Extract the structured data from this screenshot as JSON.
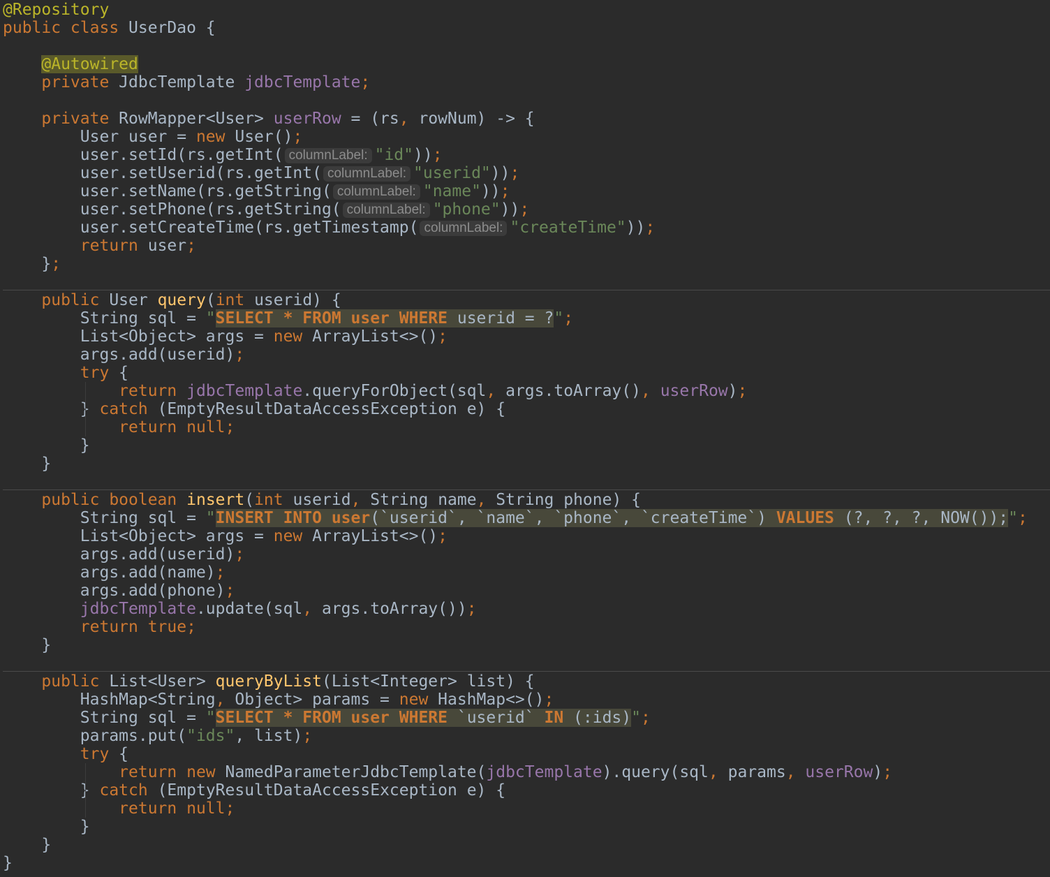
{
  "editor": {
    "lines": [
      [
        {
          "t": "@Repository",
          "c": "ann"
        }
      ],
      [
        {
          "t": "public class",
          "c": "kw"
        },
        {
          "t": " UserDao {"
        }
      ],
      [],
      [
        {
          "t": "    "
        },
        {
          "t": "@Autowired",
          "c": "ann-hl"
        }
      ],
      [
        {
          "t": "    "
        },
        {
          "t": "private",
          "c": "kw"
        },
        {
          "t": " JdbcTemplate "
        },
        {
          "t": "jdbcTemplate",
          "c": "fld"
        },
        {
          "t": ";",
          "c": "kw"
        }
      ],
      [],
      [
        {
          "t": "    "
        },
        {
          "t": "private",
          "c": "kw"
        },
        {
          "t": " RowMapper<User> "
        },
        {
          "t": "userRow",
          "c": "fld"
        },
        {
          "t": " = (rs"
        },
        {
          "t": ",",
          "c": "kw"
        },
        {
          "t": " rowNum) -> {"
        }
      ],
      [
        {
          "t": "        User user = "
        },
        {
          "t": "new",
          "c": "kw"
        },
        {
          "t": " User()"
        },
        {
          "t": ";",
          "c": "kw"
        }
      ],
      [
        {
          "t": "        user.setId(rs.getInt("
        },
        {
          "t": "columnLabel:",
          "c": "hint"
        },
        {
          "t": "\"id\"",
          "c": "str"
        },
        {
          "t": "))"
        },
        {
          "t": ";",
          "c": "kw"
        }
      ],
      [
        {
          "t": "        user.setUserid(rs.getInt("
        },
        {
          "t": "columnLabel:",
          "c": "hint"
        },
        {
          "t": "\"userid\"",
          "c": "str"
        },
        {
          "t": "))"
        },
        {
          "t": ";",
          "c": "kw"
        }
      ],
      [
        {
          "t": "        user.setName(rs.getString("
        },
        {
          "t": "columnLabel:",
          "c": "hint"
        },
        {
          "t": "\"name\"",
          "c": "str"
        },
        {
          "t": "))"
        },
        {
          "t": ";",
          "c": "kw"
        }
      ],
      [
        {
          "t": "        user.setPhone(rs.getString("
        },
        {
          "t": "columnLabel:",
          "c": "hint"
        },
        {
          "t": "\"phone\"",
          "c": "str"
        },
        {
          "t": "))"
        },
        {
          "t": ";",
          "c": "kw"
        }
      ],
      [
        {
          "t": "        user.setCreateTime(rs.getTimestamp("
        },
        {
          "t": "columnLabel:",
          "c": "hint"
        },
        {
          "t": "\"createTime\"",
          "c": "str"
        },
        {
          "t": "))"
        },
        {
          "t": ";",
          "c": "kw"
        }
      ],
      [
        {
          "t": "        "
        },
        {
          "t": "return",
          "c": "kw"
        },
        {
          "t": " user"
        },
        {
          "t": ";",
          "c": "kw"
        }
      ],
      [
        {
          "t": "    }"
        },
        {
          "t": ";",
          "c": "kw"
        }
      ],
      [],
      [
        {
          "t": "    "
        },
        {
          "t": "public",
          "c": "kw"
        },
        {
          "t": " User "
        },
        {
          "t": "query",
          "c": "fn"
        },
        {
          "t": "("
        },
        {
          "t": "int",
          "c": "kw"
        },
        {
          "t": " userid) {"
        }
      ],
      [
        {
          "t": "        String sql = "
        },
        {
          "t": "\"",
          "c": "str"
        },
        {
          "t": "SELECT * FROM user WHERE",
          "c": "sqlkw"
        },
        {
          "t": " userid = ?",
          "c": "sql"
        },
        {
          "t": "\"",
          "c": "str"
        },
        {
          "t": ";",
          "c": "kw"
        }
      ],
      [
        {
          "t": "        List<Object> args = "
        },
        {
          "t": "new",
          "c": "kw"
        },
        {
          "t": " ArrayList<>()"
        },
        {
          "t": ";",
          "c": "kw"
        }
      ],
      [
        {
          "t": "        args.add(userid)"
        },
        {
          "t": ";",
          "c": "kw"
        }
      ],
      [
        {
          "t": "        "
        },
        {
          "t": "try",
          "c": "kw"
        },
        {
          "t": " {"
        }
      ],
      [
        {
          "t": "            "
        },
        {
          "t": "return",
          "c": "kw"
        },
        {
          "t": " "
        },
        {
          "t": "jdbcTemplate",
          "c": "fld"
        },
        {
          "t": ".queryForObject(sql"
        },
        {
          "t": ",",
          "c": "kw"
        },
        {
          "t": " args.toArray()"
        },
        {
          "t": ",",
          "c": "kw"
        },
        {
          "t": " "
        },
        {
          "t": "userRow",
          "c": "fld"
        },
        {
          "t": ")"
        },
        {
          "t": ";",
          "c": "kw"
        }
      ],
      [
        {
          "t": "        } "
        },
        {
          "t": "catch",
          "c": "kw"
        },
        {
          "t": " (EmptyResultDataAccessException e) {"
        }
      ],
      [
        {
          "t": "            "
        },
        {
          "t": "return null;",
          "c": "kw"
        }
      ],
      [
        {
          "t": "        }"
        }
      ],
      [
        {
          "t": "    }"
        }
      ],
      [],
      [
        {
          "t": "    "
        },
        {
          "t": "public boolean",
          "c": "kw"
        },
        {
          "t": " "
        },
        {
          "t": "insert",
          "c": "fn"
        },
        {
          "t": "("
        },
        {
          "t": "int",
          "c": "kw"
        },
        {
          "t": " userid"
        },
        {
          "t": ",",
          "c": "kw"
        },
        {
          "t": " String name"
        },
        {
          "t": ",",
          "c": "kw"
        },
        {
          "t": " String phone) {"
        }
      ],
      [
        {
          "t": "        String sql = "
        },
        {
          "t": "\"",
          "c": "str"
        },
        {
          "t": "INSERT INTO user",
          "c": "sqlkw"
        },
        {
          "t": "(`userid`, `name`, `phone`, `createTime`) ",
          "c": "sql"
        },
        {
          "t": "VALUES",
          "c": "sqlkw"
        },
        {
          "t": " (?, ?, ?, NOW());",
          "c": "sql"
        },
        {
          "t": "\"",
          "c": "str"
        },
        {
          "t": ";",
          "c": "kw"
        }
      ],
      [
        {
          "t": "        List<Object> args = "
        },
        {
          "t": "new",
          "c": "kw"
        },
        {
          "t": " ArrayList<>()"
        },
        {
          "t": ";",
          "c": "kw"
        }
      ],
      [
        {
          "t": "        args.add(userid)"
        },
        {
          "t": ";",
          "c": "kw"
        }
      ],
      [
        {
          "t": "        args.add(name)"
        },
        {
          "t": ";",
          "c": "kw"
        }
      ],
      [
        {
          "t": "        args.add(phone)"
        },
        {
          "t": ";",
          "c": "kw"
        }
      ],
      [
        {
          "t": "        "
        },
        {
          "t": "jdbcTemplate",
          "c": "fld"
        },
        {
          "t": ".update(sql"
        },
        {
          "t": ",",
          "c": "kw"
        },
        {
          "t": " args.toArray())"
        },
        {
          "t": ";",
          "c": "kw"
        }
      ],
      [
        {
          "t": "        "
        },
        {
          "t": "return true;",
          "c": "kw"
        }
      ],
      [
        {
          "t": "    }"
        }
      ],
      [],
      [
        {
          "t": "    "
        },
        {
          "t": "public",
          "c": "kw"
        },
        {
          "t": " List<User> "
        },
        {
          "t": "queryByList",
          "c": "fn"
        },
        {
          "t": "(List<Integer> list) {"
        }
      ],
      [
        {
          "t": "        HashMap<String"
        },
        {
          "t": ",",
          "c": "kw"
        },
        {
          "t": " Object> params = "
        },
        {
          "t": "new",
          "c": "kw"
        },
        {
          "t": " HashMap<>()"
        },
        {
          "t": ";",
          "c": "kw"
        }
      ],
      [
        {
          "t": "        String sql = "
        },
        {
          "t": "\"",
          "c": "str"
        },
        {
          "t": "SELECT * FROM user WHERE",
          "c": "sqlkw"
        },
        {
          "t": " `userid` ",
          "c": "sql"
        },
        {
          "t": "IN",
          "c": "sqlkw"
        },
        {
          "t": " (:ids)",
          "c": "sql"
        },
        {
          "t": "\"",
          "c": "str"
        },
        {
          "t": ";",
          "c": "kw"
        }
      ],
      [
        {
          "t": "        params.put("
        },
        {
          "t": "\"ids\"",
          "c": "str"
        },
        {
          "t": ","
        },
        {
          "t": " list)"
        },
        {
          "t": ";",
          "c": "kw"
        }
      ],
      [
        {
          "t": "        "
        },
        {
          "t": "try",
          "c": "kw"
        },
        {
          "t": " {"
        }
      ],
      [
        {
          "t": "            "
        },
        {
          "t": "return new",
          "c": "kw"
        },
        {
          "t": " NamedParameterJdbcTemplate("
        },
        {
          "t": "jdbcTemplate",
          "c": "fld"
        },
        {
          "t": ").query(sql"
        },
        {
          "t": ",",
          "c": "kw"
        },
        {
          "t": " params"
        },
        {
          "t": ",",
          "c": "kw"
        },
        {
          "t": " "
        },
        {
          "t": "userRow",
          "c": "fld"
        },
        {
          "t": ")"
        },
        {
          "t": ";",
          "c": "kw"
        }
      ],
      [
        {
          "t": "        } "
        },
        {
          "t": "catch",
          "c": "kw"
        },
        {
          "t": " (EmptyResultDataAccessException e) {"
        }
      ],
      [
        {
          "t": "            "
        },
        {
          "t": "return null;",
          "c": "kw"
        }
      ],
      [
        {
          "t": "        }"
        }
      ],
      [
        {
          "t": "    }"
        }
      ],
      [
        {
          "t": "}"
        }
      ]
    ]
  },
  "colors": {
    "background": "#2b2b2b",
    "text": "#a9b7c6",
    "keyword": "#cc7832",
    "annotation": "#bbb529",
    "string": "#6a8759",
    "field": "#9876aa",
    "method": "#ffc66d",
    "hint": "#8c8c8c",
    "sql_injection_bg": "#48483a"
  }
}
